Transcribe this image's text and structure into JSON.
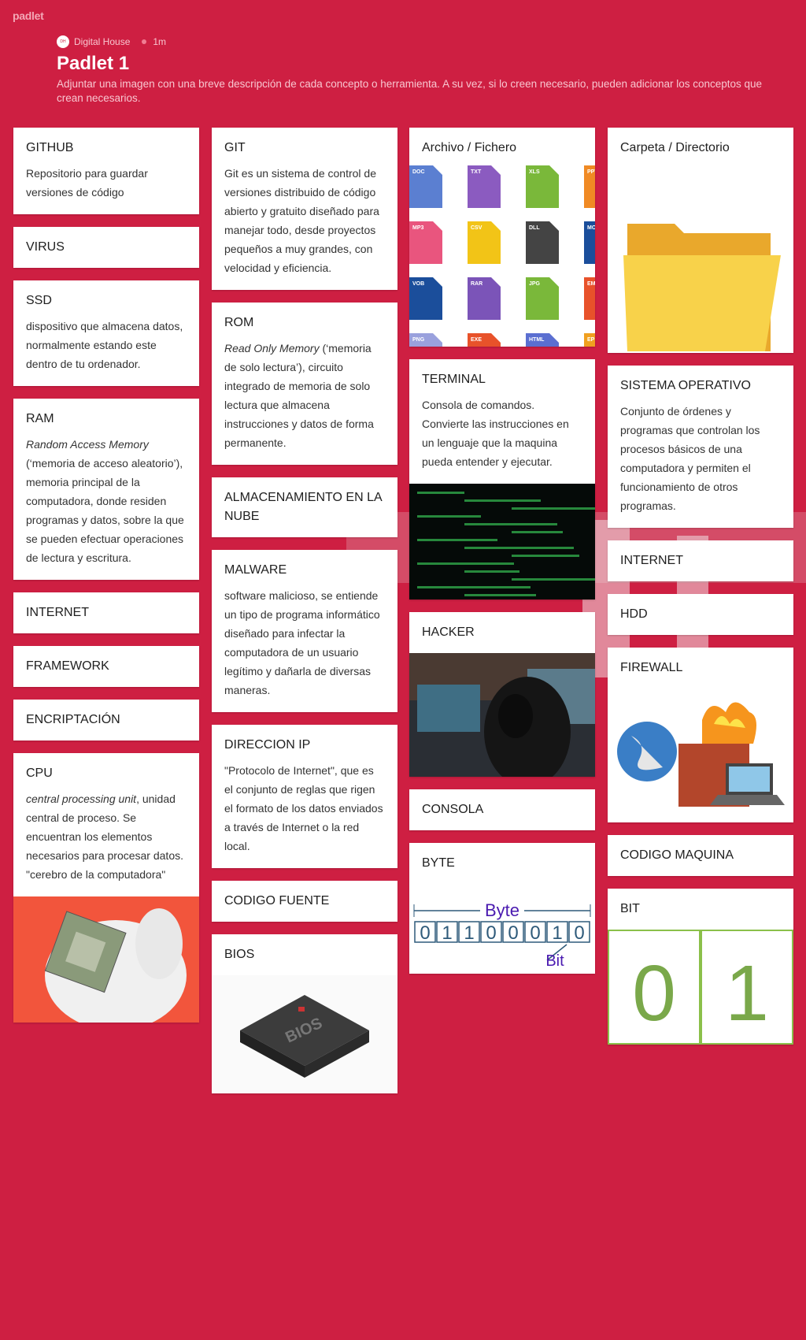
{
  "brand": "padlet",
  "header": {
    "author": "Digital House",
    "time": "1m",
    "title": "Padlet 1",
    "description": "Adjuntar una imagen con una breve descripción de cada concepto o herramienta. A su vez, si lo creen necesario, pueden adicionar los conceptos que crean necesarios."
  },
  "columns": [
    [
      {
        "title": "GITHUB",
        "body": "Repositorio para guardar versiones de código"
      },
      {
        "title": "VIRUS"
      },
      {
        "title": "SSD",
        "body": "dispositivo que almacena datos, normalmente estando este dentro de tu ordenador."
      },
      {
        "title": "RAM",
        "body_em": "Random Access Memory",
        "body": " (‘memoria de acceso aleatorio’), memoria principal de la computadora, donde residen programas y datos, sobre la que se pueden efectuar operaciones de lectura y escritura."
      },
      {
        "title": "INTERNET"
      },
      {
        "title": "FRAMEWORK"
      },
      {
        "title": "ENCRIPTACIÓN"
      },
      {
        "title": "CPU",
        "body_em": "central processing unit",
        "body": ", unidad central de proceso. Se encuentran los elementos necesarios para procesar datos. \"cerebro de la computadora\"",
        "media": "cpu"
      }
    ],
    [
      {
        "title": "GIT",
        "body": "Git es un sistema de control de versiones distribuido de código abierto y gratuito diseñado para manejar todo, desde proyectos pequeños a muy grandes, con velocidad y eficiencia."
      },
      {
        "title": "ROM",
        "body_em": "Read Only Memory",
        "body": " (‘memoria de solo lectura’), circuito integrado de memoria de solo lectura que almacena instrucciones y datos de forma permanente."
      },
      {
        "title": "ALMACENAMIENTO EN LA NUBE"
      },
      {
        "title": "MALWARE",
        "body": "software malicioso, se entiende un tipo de programa informático diseñado para infectar la computadora de un usuario legítimo y dañarla de diversas maneras."
      },
      {
        "title": "DIRECCION IP",
        "body": "\"Protocolo de Internet\", que es el conjunto de reglas que rigen el formato de los datos enviados a través de Internet o la red local."
      },
      {
        "title": "CODIGO FUENTE"
      },
      {
        "title": "BIOS",
        "media": "bios"
      }
    ],
    [
      {
        "title": "Archivo / Fichero",
        "media": "files"
      },
      {
        "title": "TERMINAL",
        "body": "Consola de comandos. Convierte las instrucciones en un lenguaje que la maquina pueda entender y ejecutar.",
        "media": "terminal"
      },
      {
        "title": "HACKER",
        "media": "hacker"
      },
      {
        "title": "CONSOLA"
      },
      {
        "title": "BYTE",
        "media": "byte"
      }
    ],
    [
      {
        "title": "Carpeta / Directorio",
        "media": "folder"
      },
      {
        "title": "SISTEMA OPERATIVO",
        "body": "Conjunto de órdenes y programas que controlan los procesos básicos de una computadora y permiten el funcionamiento de otros programas."
      },
      {
        "title": "INTERNET"
      },
      {
        "title": "HDD"
      },
      {
        "title": "FIREWALL",
        "media": "firewall"
      },
      {
        "title": "CODIGO MAQUINA"
      },
      {
        "title": "BIT",
        "media": "bit"
      }
    ]
  ],
  "file_icons": [
    "DOC",
    "TXT",
    "XLS",
    "PPT",
    "MP3",
    "CSV",
    "DLL",
    "MO",
    "VOB",
    "RAR",
    "JPG",
    "EM",
    "PNG",
    "EXE",
    "HTML",
    "EP"
  ],
  "bios_label": "BIOS",
  "byte_diagram": {
    "label": "Byte",
    "bits": "01100010",
    "bit_label": "Bit"
  },
  "bit_digits": [
    "0",
    "1"
  ],
  "colors": {
    "background": "#ce1f42",
    "card": "#ffffff"
  }
}
